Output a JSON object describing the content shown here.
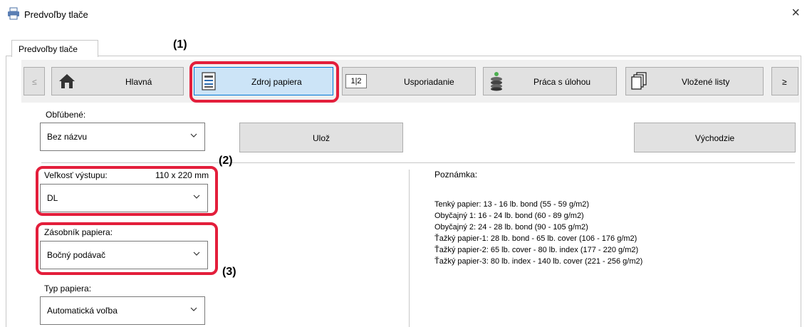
{
  "window": {
    "title": "Predvoľby tlače",
    "close_glyph": "×"
  },
  "tab": {
    "label": "Predvoľby tlače"
  },
  "nav": {
    "prev_label": "≤",
    "next_label": "≥",
    "buttons": [
      {
        "label": "Hlavná",
        "icon": "home-icon"
      },
      {
        "label": "Zdroj papiera",
        "icon": "paper-tray-icon",
        "selected": true
      },
      {
        "label": "Usporiadanie",
        "icon": "layout-icon",
        "layout_text": "1|2"
      },
      {
        "label": "Práca s úlohou",
        "icon": "job-stack-icon"
      },
      {
        "label": "Vložené listy",
        "icon": "inserted-sheets-icon"
      }
    ]
  },
  "favorites": {
    "label": "Obľúbené:",
    "value": "Bez názvu",
    "save_button": "Ulož",
    "defaults_button": "Východzie"
  },
  "output_size": {
    "label": "Veľkosť výstupu:",
    "dimension": "110 x 220 mm",
    "value": "DL"
  },
  "paper_tray": {
    "label": "Zásobník papiera:",
    "value": "Bočný podávač"
  },
  "paper_type": {
    "label": "Typ papiera:",
    "value": "Automatická voľba"
  },
  "note": {
    "title": "Poznámka:",
    "lines": [
      "Tenký papier: 13 - 16 lb. bond (55 - 59 g/m2)",
      "Obyčajný 1: 16 - 24 lb. bond (60 - 89 g/m2)",
      "Obyčajný 2: 24 - 28 lb. bond (90 - 105 g/m2)",
      "Ťažký papier-1: 28 lb. bond - 65 lb. cover (106 - 176 g/m2)",
      "Ťažký papier-2: 65 lb. cover - 80 lb. index (177 - 220 g/m2)",
      "Ťažký papier-3: 80 lb. index - 140 lb. cover (221 - 256 g/m2)"
    ]
  },
  "callouts": {
    "c1": "(1)",
    "c2": "(2)",
    "c3": "(3)"
  },
  "colors": {
    "callout": "#e31e3b",
    "selected_bg": "#cce4f7",
    "selected_border": "#0078d7"
  }
}
